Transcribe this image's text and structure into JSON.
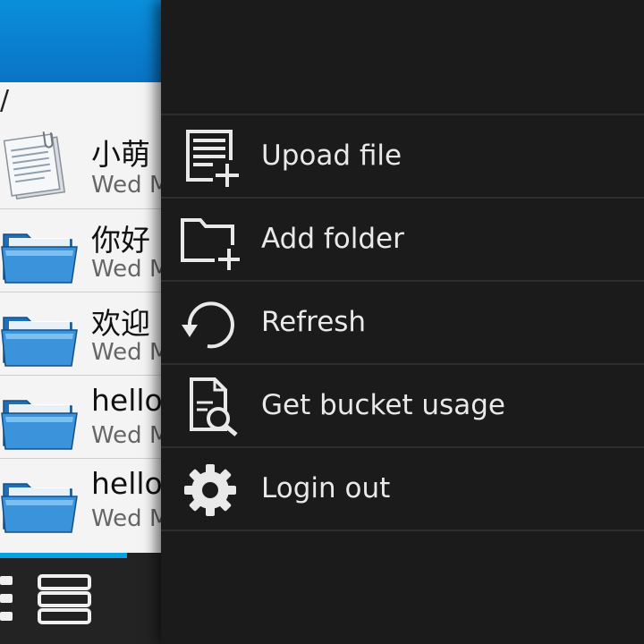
{
  "path_bar": {
    "path": "/"
  },
  "files": [
    {
      "name": "小萌",
      "date": "Wed M",
      "icon": "document-icon"
    },
    {
      "name": "你好",
      "date": "Wed M",
      "icon": "folder-icon"
    },
    {
      "name": "欢迎",
      "date": "Wed M",
      "icon": "folder-icon"
    },
    {
      "name": "hello",
      "date": "Wed M",
      "icon": "folder-icon"
    },
    {
      "name": "hello",
      "date": "Wed M",
      "icon": "folder-icon"
    }
  ],
  "menu": {
    "items": [
      {
        "label": "Upoad file",
        "icon": "upload-file-icon"
      },
      {
        "label": "Add folder",
        "icon": "add-folder-icon"
      },
      {
        "label": "Refresh",
        "icon": "refresh-icon"
      },
      {
        "label": "Get bucket usage",
        "icon": "search-document-icon"
      },
      {
        "label": "Login out",
        "icon": "gear-icon"
      }
    ]
  },
  "colors": {
    "header_blue": "#0a80d0",
    "menu_background": "#1b1b1b",
    "menu_text": "#e9e9e9",
    "tab_accent": "#0aa0e4"
  }
}
